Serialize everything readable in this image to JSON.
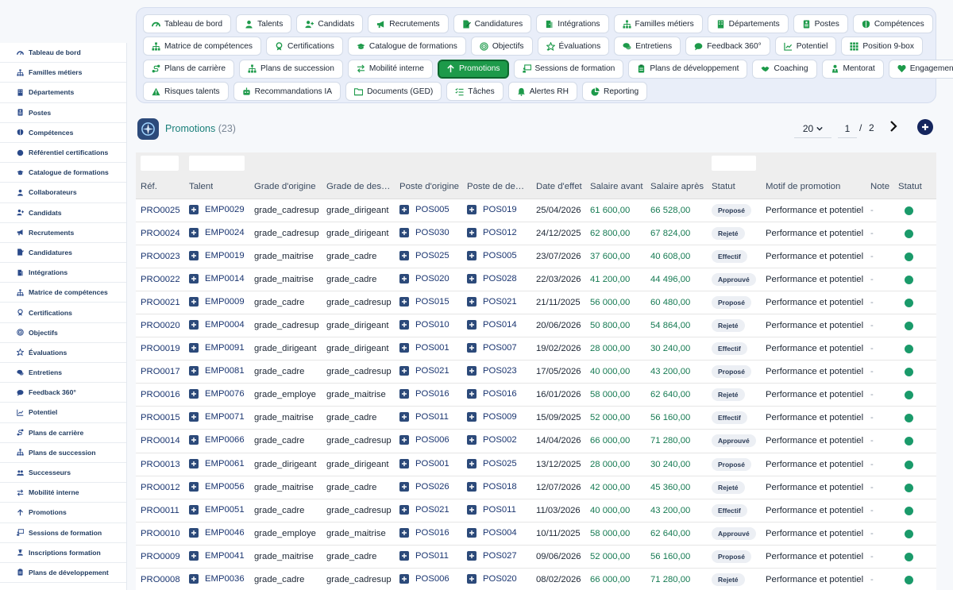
{
  "sidebar": {
    "items": [
      {
        "label": "Tableau de bord",
        "icon": "dashboard-icon"
      },
      {
        "label": "Familles métiers",
        "icon": "hierarchy-icon"
      },
      {
        "label": "Départements",
        "icon": "building-icon"
      },
      {
        "label": "Postes",
        "icon": "id-card-icon"
      },
      {
        "label": "Compétences",
        "icon": "brain-icon"
      },
      {
        "label": "Référentiel certifications",
        "icon": "certificate-icon"
      },
      {
        "label": "Catalogue de formations",
        "icon": "graduation-cap-icon"
      },
      {
        "label": "Collaborateurs",
        "icon": "user-icon"
      },
      {
        "label": "Candidats",
        "icon": "user-plus-icon"
      },
      {
        "label": "Recrutements",
        "icon": "megaphone-icon"
      },
      {
        "label": "Candidatures",
        "icon": "file-signature-icon"
      },
      {
        "label": "Intégrations",
        "icon": "door-icon"
      },
      {
        "label": "Matrice de compétences",
        "icon": "hierarchy-icon"
      },
      {
        "label": "Certifications",
        "icon": "award-icon"
      },
      {
        "label": "Objectifs",
        "icon": "target-icon"
      },
      {
        "label": "Évaluations",
        "icon": "star-icon"
      },
      {
        "label": "Entretiens",
        "icon": "comments-icon"
      },
      {
        "label": "Feedback 360°",
        "icon": "comment-icon"
      },
      {
        "label": "Potentiel",
        "icon": "chart-icon"
      },
      {
        "label": "Plans de carrière",
        "icon": "route-icon"
      },
      {
        "label": "Plans de succession",
        "icon": "hierarchy-icon"
      },
      {
        "label": "Successeurs",
        "icon": "users-icon"
      },
      {
        "label": "Mobilité interne",
        "icon": "exchange-icon"
      },
      {
        "label": "Promotions",
        "icon": "arrow-up-icon"
      },
      {
        "label": "Sessions de formation",
        "icon": "chalkboard-icon"
      },
      {
        "label": "Inscriptions formation",
        "icon": "user-graduate-icon"
      },
      {
        "label": "Plans de développement",
        "icon": "clipboard-icon"
      }
    ]
  },
  "nav": {
    "rows": [
      [
        {
          "label": "Tableau de bord",
          "icon": "dashboard-icon"
        },
        {
          "label": "Talents",
          "icon": "user-icon"
        },
        {
          "label": "Candidats",
          "icon": "user-plus-icon"
        },
        {
          "label": "Recrutements",
          "icon": "megaphone-icon"
        },
        {
          "label": "Candidatures",
          "icon": "file-signature-icon"
        },
        {
          "label": "Intégrations",
          "icon": "door-icon"
        },
        {
          "label": "Familles métiers",
          "icon": "hierarchy-icon"
        },
        {
          "label": "Départements",
          "icon": "building-icon"
        },
        {
          "label": "Postes",
          "icon": "id-card-icon"
        },
        {
          "label": "Compétences",
          "icon": "brain-icon"
        }
      ],
      [
        {
          "label": "Matrice de compétences",
          "icon": "hierarchy-icon"
        },
        {
          "label": "Certifications",
          "icon": "award-icon"
        },
        {
          "label": "Catalogue de formations",
          "icon": "graduation-cap-icon"
        },
        {
          "label": "Objectifs",
          "icon": "target-icon"
        },
        {
          "label": "Évaluations",
          "icon": "star-icon"
        },
        {
          "label": "Entretiens",
          "icon": "comments-icon"
        },
        {
          "label": "Feedback 360°",
          "icon": "comment-icon"
        },
        {
          "label": "Potentiel",
          "icon": "chart-icon"
        },
        {
          "label": "Position 9-box",
          "icon": "grid-icon"
        }
      ],
      [
        {
          "label": "Plans de carrière",
          "icon": "route-icon"
        },
        {
          "label": "Plans de succession",
          "icon": "hierarchy-icon"
        },
        {
          "label": "Mobilité interne",
          "icon": "exchange-icon"
        },
        {
          "label": "Promotions",
          "icon": "arrow-up-icon",
          "active": true
        },
        {
          "label": "Sessions de formation",
          "icon": "chalkboard-icon"
        },
        {
          "label": "Plans de développement",
          "icon": "clipboard-icon"
        },
        {
          "label": "Coaching",
          "icon": "handshake-icon"
        },
        {
          "label": "Mentorat",
          "icon": "mentor-icon"
        },
        {
          "label": "Engagement",
          "icon": "heart-icon"
        }
      ],
      [
        {
          "label": "Risques talents",
          "icon": "warning-icon"
        },
        {
          "label": "Recommandations IA",
          "icon": "robot-icon"
        },
        {
          "label": "Documents (GED)",
          "icon": "folder-icon"
        },
        {
          "label": "Tâches",
          "icon": "tasks-icon"
        },
        {
          "label": "Alertes RH",
          "icon": "bell-icon"
        },
        {
          "label": "Reporting",
          "icon": "pie-chart-icon"
        }
      ]
    ]
  },
  "header": {
    "title": "Promotions",
    "count": "(23)",
    "page_size": "20",
    "current_page": "1",
    "separator": "/",
    "total_pages": "2"
  },
  "table": {
    "headers": [
      "Réf.",
      "Talent",
      "Grade d'origine",
      "Grade de des…",
      "Poste d'origine",
      "Poste de de…",
      "Date d'effet",
      "Salaire avant",
      "Salaire après",
      "Statut",
      "Motif de promotion",
      "Note",
      "Statut"
    ],
    "rows": [
      {
        "ref": "PRO0025",
        "talent": "EMP0029",
        "grade_from": "grade_cadresup",
        "grade_to": "grade_dirigeant",
        "pos_from": "POS005",
        "pos_to": "POS019",
        "date": "25/04/2026",
        "sal_before": "61 600,00",
        "sal_after": "66 528,00",
        "status": "Proposé",
        "motif": "Performance et potentiel",
        "note": "-"
      },
      {
        "ref": "PRO0024",
        "talent": "EMP0024",
        "grade_from": "grade_cadresup",
        "grade_to": "grade_dirigeant",
        "pos_from": "POS030",
        "pos_to": "POS012",
        "date": "24/12/2025",
        "sal_before": "62 800,00",
        "sal_after": "67 824,00",
        "status": "Rejeté",
        "motif": "Performance et potentiel",
        "note": "-"
      },
      {
        "ref": "PRO0023",
        "talent": "EMP0019",
        "grade_from": "grade_maitrise",
        "grade_to": "grade_cadre",
        "pos_from": "POS025",
        "pos_to": "POS005",
        "date": "23/07/2026",
        "sal_before": "37 600,00",
        "sal_after": "40 608,00",
        "status": "Effectif",
        "motif": "Performance et potentiel",
        "note": "-"
      },
      {
        "ref": "PRO0022",
        "talent": "EMP0014",
        "grade_from": "grade_maitrise",
        "grade_to": "grade_cadre",
        "pos_from": "POS020",
        "pos_to": "POS028",
        "date": "22/03/2026",
        "sal_before": "41 200,00",
        "sal_after": "44 496,00",
        "status": "Approuvé",
        "motif": "Performance et potentiel",
        "note": "-"
      },
      {
        "ref": "PRO0021",
        "talent": "EMP0009",
        "grade_from": "grade_cadre",
        "grade_to": "grade_cadresup",
        "pos_from": "POS015",
        "pos_to": "POS021",
        "date": "21/11/2025",
        "sal_before": "56 000,00",
        "sal_after": "60 480,00",
        "status": "Proposé",
        "motif": "Performance et potentiel",
        "note": "-"
      },
      {
        "ref": "PRO0020",
        "talent": "EMP0004",
        "grade_from": "grade_cadresup",
        "grade_to": "grade_dirigeant",
        "pos_from": "POS010",
        "pos_to": "POS014",
        "date": "20/06/2026",
        "sal_before": "50 800,00",
        "sal_after": "54 864,00",
        "status": "Rejeté",
        "motif": "Performance et potentiel",
        "note": "-"
      },
      {
        "ref": "PRO0019",
        "talent": "EMP0091",
        "grade_from": "grade_dirigeant",
        "grade_to": "grade_dirigeant",
        "pos_from": "POS001",
        "pos_to": "POS007",
        "date": "19/02/2026",
        "sal_before": "28 000,00",
        "sal_after": "30 240,00",
        "status": "Effectif",
        "motif": "Performance et potentiel",
        "note": "-"
      },
      {
        "ref": "PRO0017",
        "talent": "EMP0081",
        "grade_from": "grade_cadre",
        "grade_to": "grade_cadresup",
        "pos_from": "POS021",
        "pos_to": "POS023",
        "date": "17/05/2026",
        "sal_before": "40 000,00",
        "sal_after": "43 200,00",
        "status": "Proposé",
        "motif": "Performance et potentiel",
        "note": "-"
      },
      {
        "ref": "PRO0016",
        "talent": "EMP0076",
        "grade_from": "grade_employe",
        "grade_to": "grade_maitrise",
        "pos_from": "POS016",
        "pos_to": "POS016",
        "date": "16/01/2026",
        "sal_before": "58 000,00",
        "sal_after": "62 640,00",
        "status": "Rejeté",
        "motif": "Performance et potentiel",
        "note": "-"
      },
      {
        "ref": "PRO0015",
        "talent": "EMP0071",
        "grade_from": "grade_maitrise",
        "grade_to": "grade_cadre",
        "pos_from": "POS011",
        "pos_to": "POS009",
        "date": "15/09/2025",
        "sal_before": "52 000,00",
        "sal_after": "56 160,00",
        "status": "Effectif",
        "motif": "Performance et potentiel",
        "note": "-"
      },
      {
        "ref": "PRO0014",
        "talent": "EMP0066",
        "grade_from": "grade_cadre",
        "grade_to": "grade_cadresup",
        "pos_from": "POS006",
        "pos_to": "POS002",
        "date": "14/04/2026",
        "sal_before": "66 000,00",
        "sal_after": "71 280,00",
        "status": "Approuvé",
        "motif": "Performance et potentiel",
        "note": "-"
      },
      {
        "ref": "PRO0013",
        "talent": "EMP0061",
        "grade_from": "grade_dirigeant",
        "grade_to": "grade_dirigeant",
        "pos_from": "POS001",
        "pos_to": "POS025",
        "date": "13/12/2025",
        "sal_before": "28 000,00",
        "sal_after": "30 240,00",
        "status": "Proposé",
        "motif": "Performance et potentiel",
        "note": "-"
      },
      {
        "ref": "PRO0012",
        "talent": "EMP0056",
        "grade_from": "grade_maitrise",
        "grade_to": "grade_cadre",
        "pos_from": "POS026",
        "pos_to": "POS018",
        "date": "12/07/2026",
        "sal_before": "42 000,00",
        "sal_after": "45 360,00",
        "status": "Rejeté",
        "motif": "Performance et potentiel",
        "note": "-"
      },
      {
        "ref": "PRO0011",
        "talent": "EMP0051",
        "grade_from": "grade_cadre",
        "grade_to": "grade_cadresup",
        "pos_from": "POS021",
        "pos_to": "POS011",
        "date": "11/03/2026",
        "sal_before": "40 000,00",
        "sal_after": "43 200,00",
        "status": "Effectif",
        "motif": "Performance et potentiel",
        "note": "-"
      },
      {
        "ref": "PRO0010",
        "talent": "EMP0046",
        "grade_from": "grade_employe",
        "grade_to": "grade_maitrise",
        "pos_from": "POS016",
        "pos_to": "POS004",
        "date": "10/11/2025",
        "sal_before": "58 000,00",
        "sal_after": "62 640,00",
        "status": "Approuvé",
        "motif": "Performance et potentiel",
        "note": "-"
      },
      {
        "ref": "PRO0009",
        "talent": "EMP0041",
        "grade_from": "grade_maitrise",
        "grade_to": "grade_cadre",
        "pos_from": "POS011",
        "pos_to": "POS027",
        "date": "09/06/2026",
        "sal_before": "52 000,00",
        "sal_after": "56 160,00",
        "status": "Proposé",
        "motif": "Performance et potentiel",
        "note": "-"
      },
      {
        "ref": "PRO0008",
        "talent": "EMP0036",
        "grade_from": "grade_cadre",
        "grade_to": "grade_cadresup",
        "pos_from": "POS006",
        "pos_to": "POS020",
        "date": "08/02/2026",
        "sal_before": "66 000,00",
        "sal_after": "71 280,00",
        "status": "Rejeté",
        "motif": "Performance et potentiel",
        "note": "-"
      }
    ]
  },
  "colors": {
    "accent_green": "#1d9a4a",
    "money_green": "#157a52",
    "status_dot": "#1a9a6a",
    "navy": "#15265e",
    "link": "#1a3570"
  }
}
